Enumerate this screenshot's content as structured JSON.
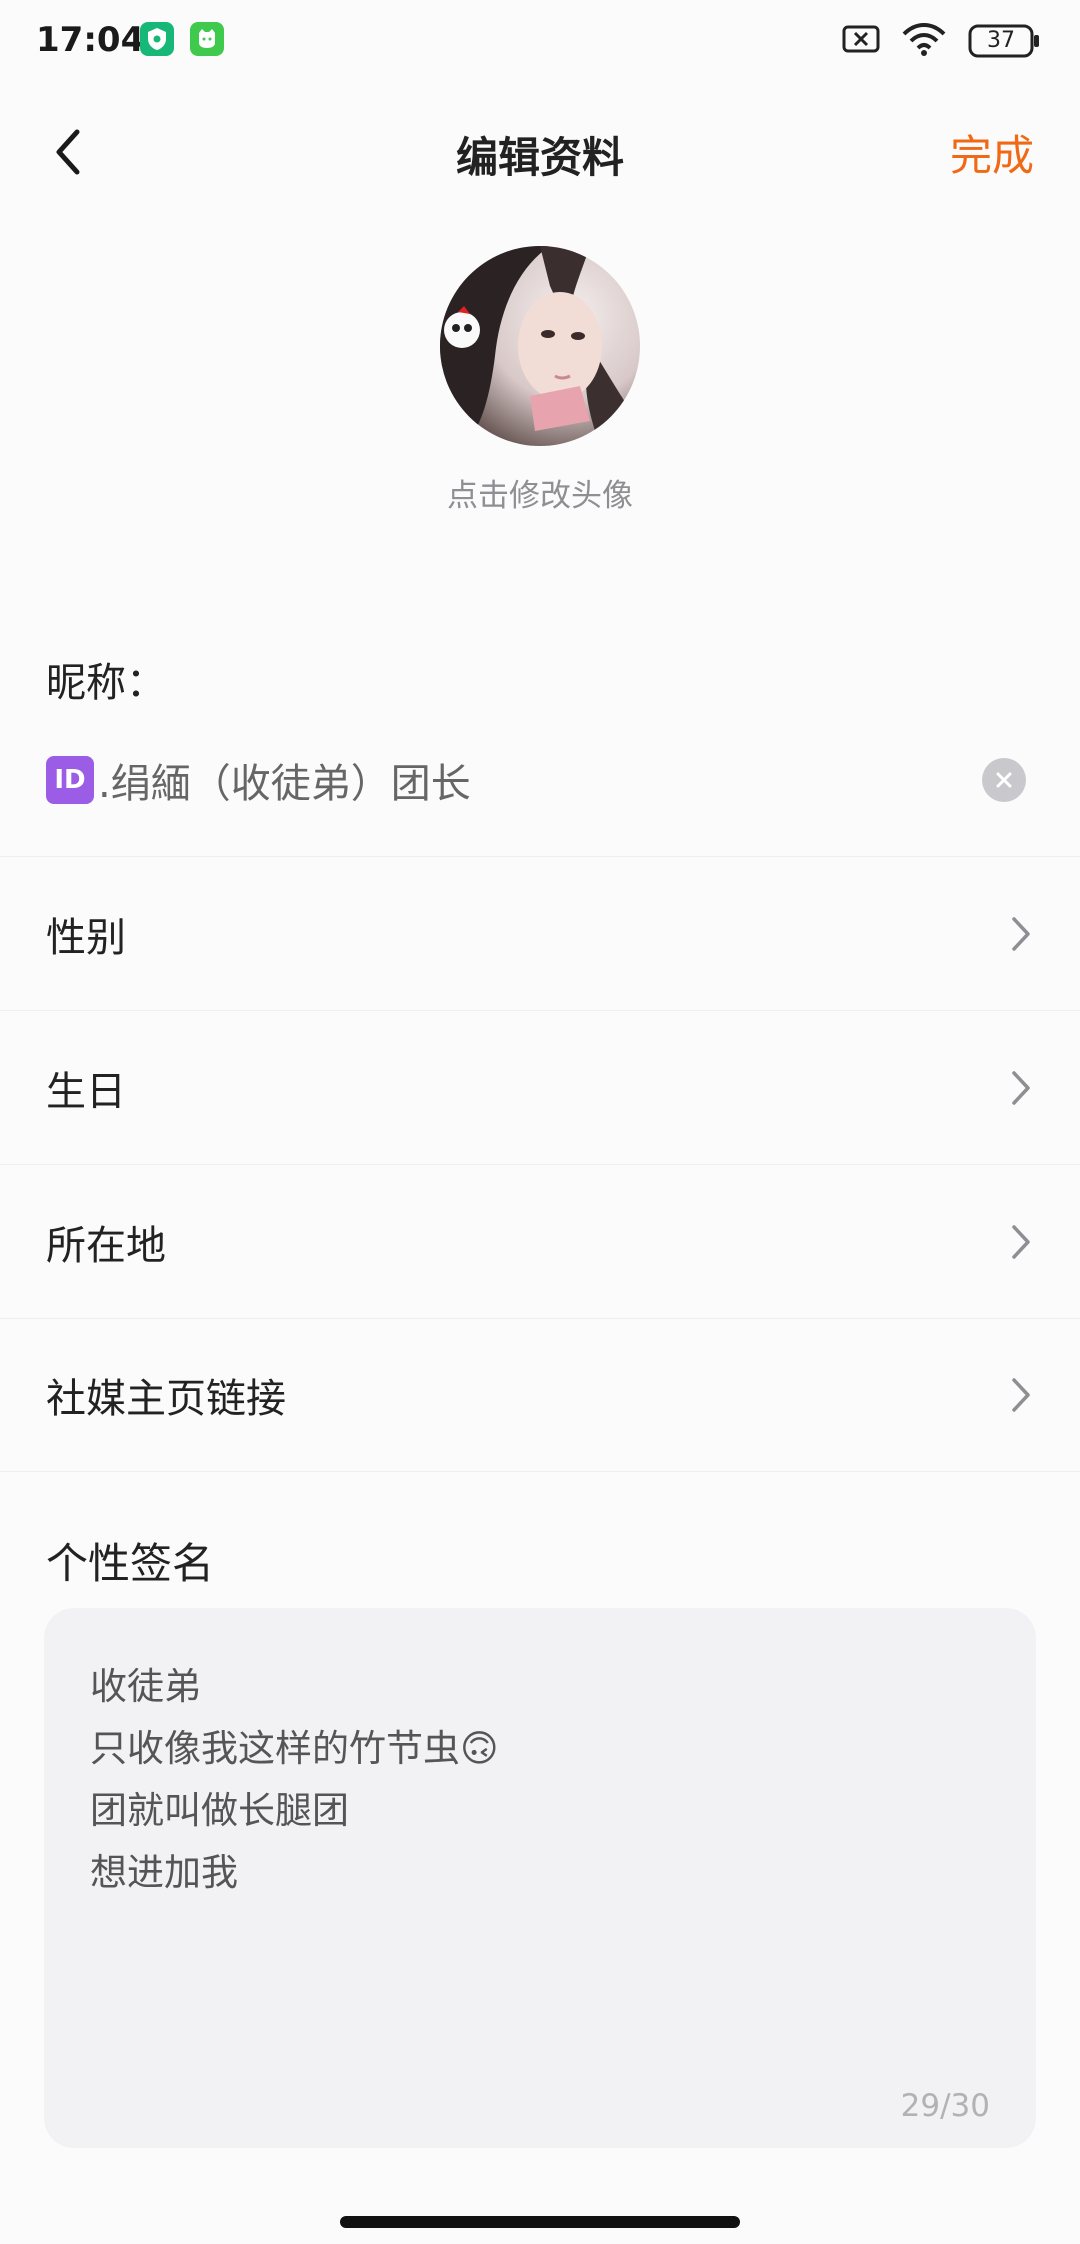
{
  "status_bar": {
    "time": "17:04",
    "battery": "37",
    "icons": [
      "shield-app-icon",
      "cat-app-icon",
      "no-sim-icon",
      "wifi-icon",
      "battery-icon"
    ]
  },
  "nav": {
    "title": "编辑资料",
    "done_label": "完成",
    "done_color": "#f06a15"
  },
  "avatar": {
    "caption": "点击修改头像"
  },
  "nickname": {
    "label": "昵称：",
    "badge": "ID",
    "value": ".绢緬（收徒弟）团长"
  },
  "menu": [
    {
      "label": "性别"
    },
    {
      "label": "生日"
    },
    {
      "label": "所在地"
    },
    {
      "label": "社媒主页链接"
    }
  ],
  "bio": {
    "label": "个性签名",
    "lines": [
      "收徒弟",
      "只收像我这样的竹节虫🙃",
      "团就叫做长腿团",
      "想进加我"
    ],
    "count": "29/30"
  }
}
